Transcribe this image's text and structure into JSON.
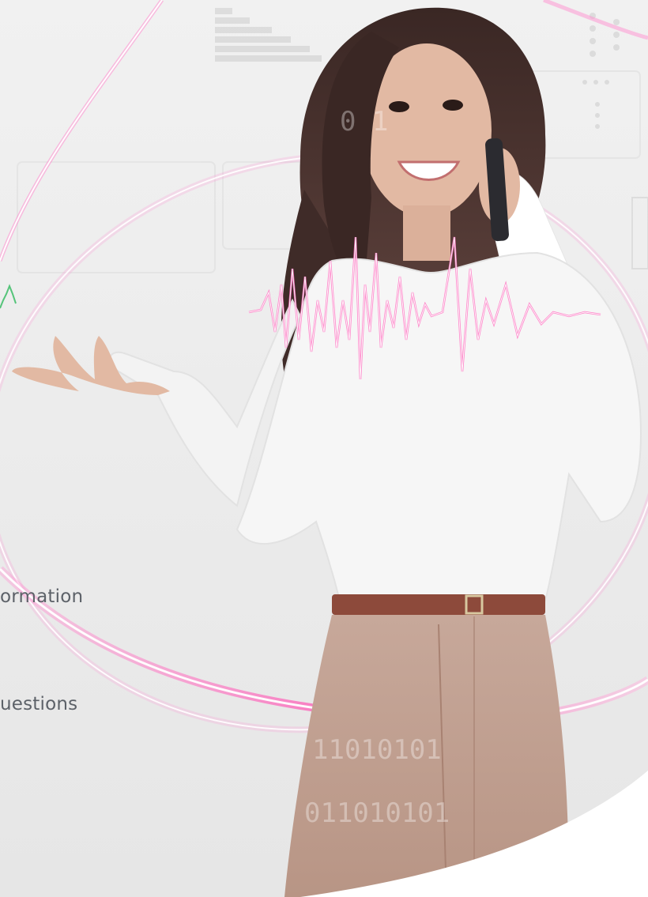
{
  "menu": {
    "items": [
      {
        "label": "ormation"
      },
      {
        "label": "uestions"
      }
    ]
  },
  "colors": {
    "background": "#ececec",
    "text": "#5c6168",
    "accent_pink": "#ff5fb8",
    "accent_green": "#55c47a"
  },
  "icons": {
    "hero_visual": "woman-on-phone-illustration",
    "waveform": "audio-waveform-icon",
    "bar_meter": "bar-meter-icon"
  }
}
